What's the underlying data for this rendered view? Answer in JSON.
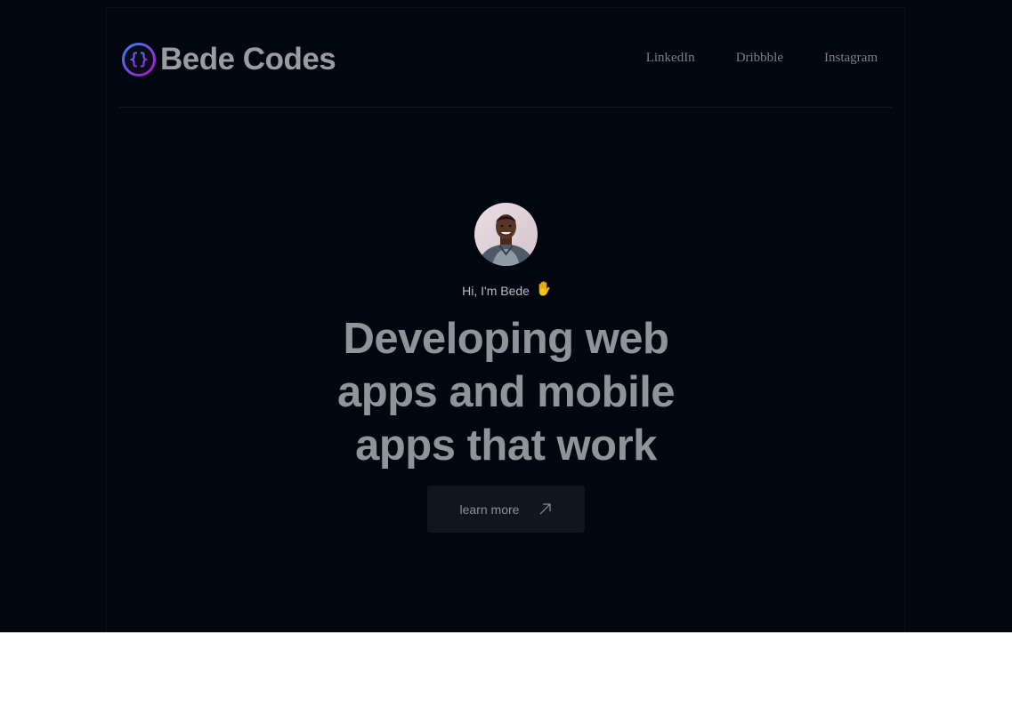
{
  "brand": {
    "name": "Bede Codes",
    "logo_icon": "curly-braces-icon",
    "logo_gradient": [
      "#3b82f6",
      "#a21caf"
    ]
  },
  "nav": {
    "items": [
      {
        "label": "LinkedIn"
      },
      {
        "label": "Dribbble"
      },
      {
        "label": "Instagram"
      }
    ]
  },
  "hero": {
    "greeting": "Hi, I'm Bede",
    "greeting_icon": "raised-hand-icon",
    "headline_lines": [
      "Developing web",
      "apps and mobile",
      "apps that work"
    ],
    "cta_label": "learn more",
    "cta_icon": "arrow-up-right-icon"
  },
  "colors": {
    "background": "#02060e",
    "headline": "#8f939a",
    "button": "#11151d",
    "wave": "#f5c518"
  }
}
